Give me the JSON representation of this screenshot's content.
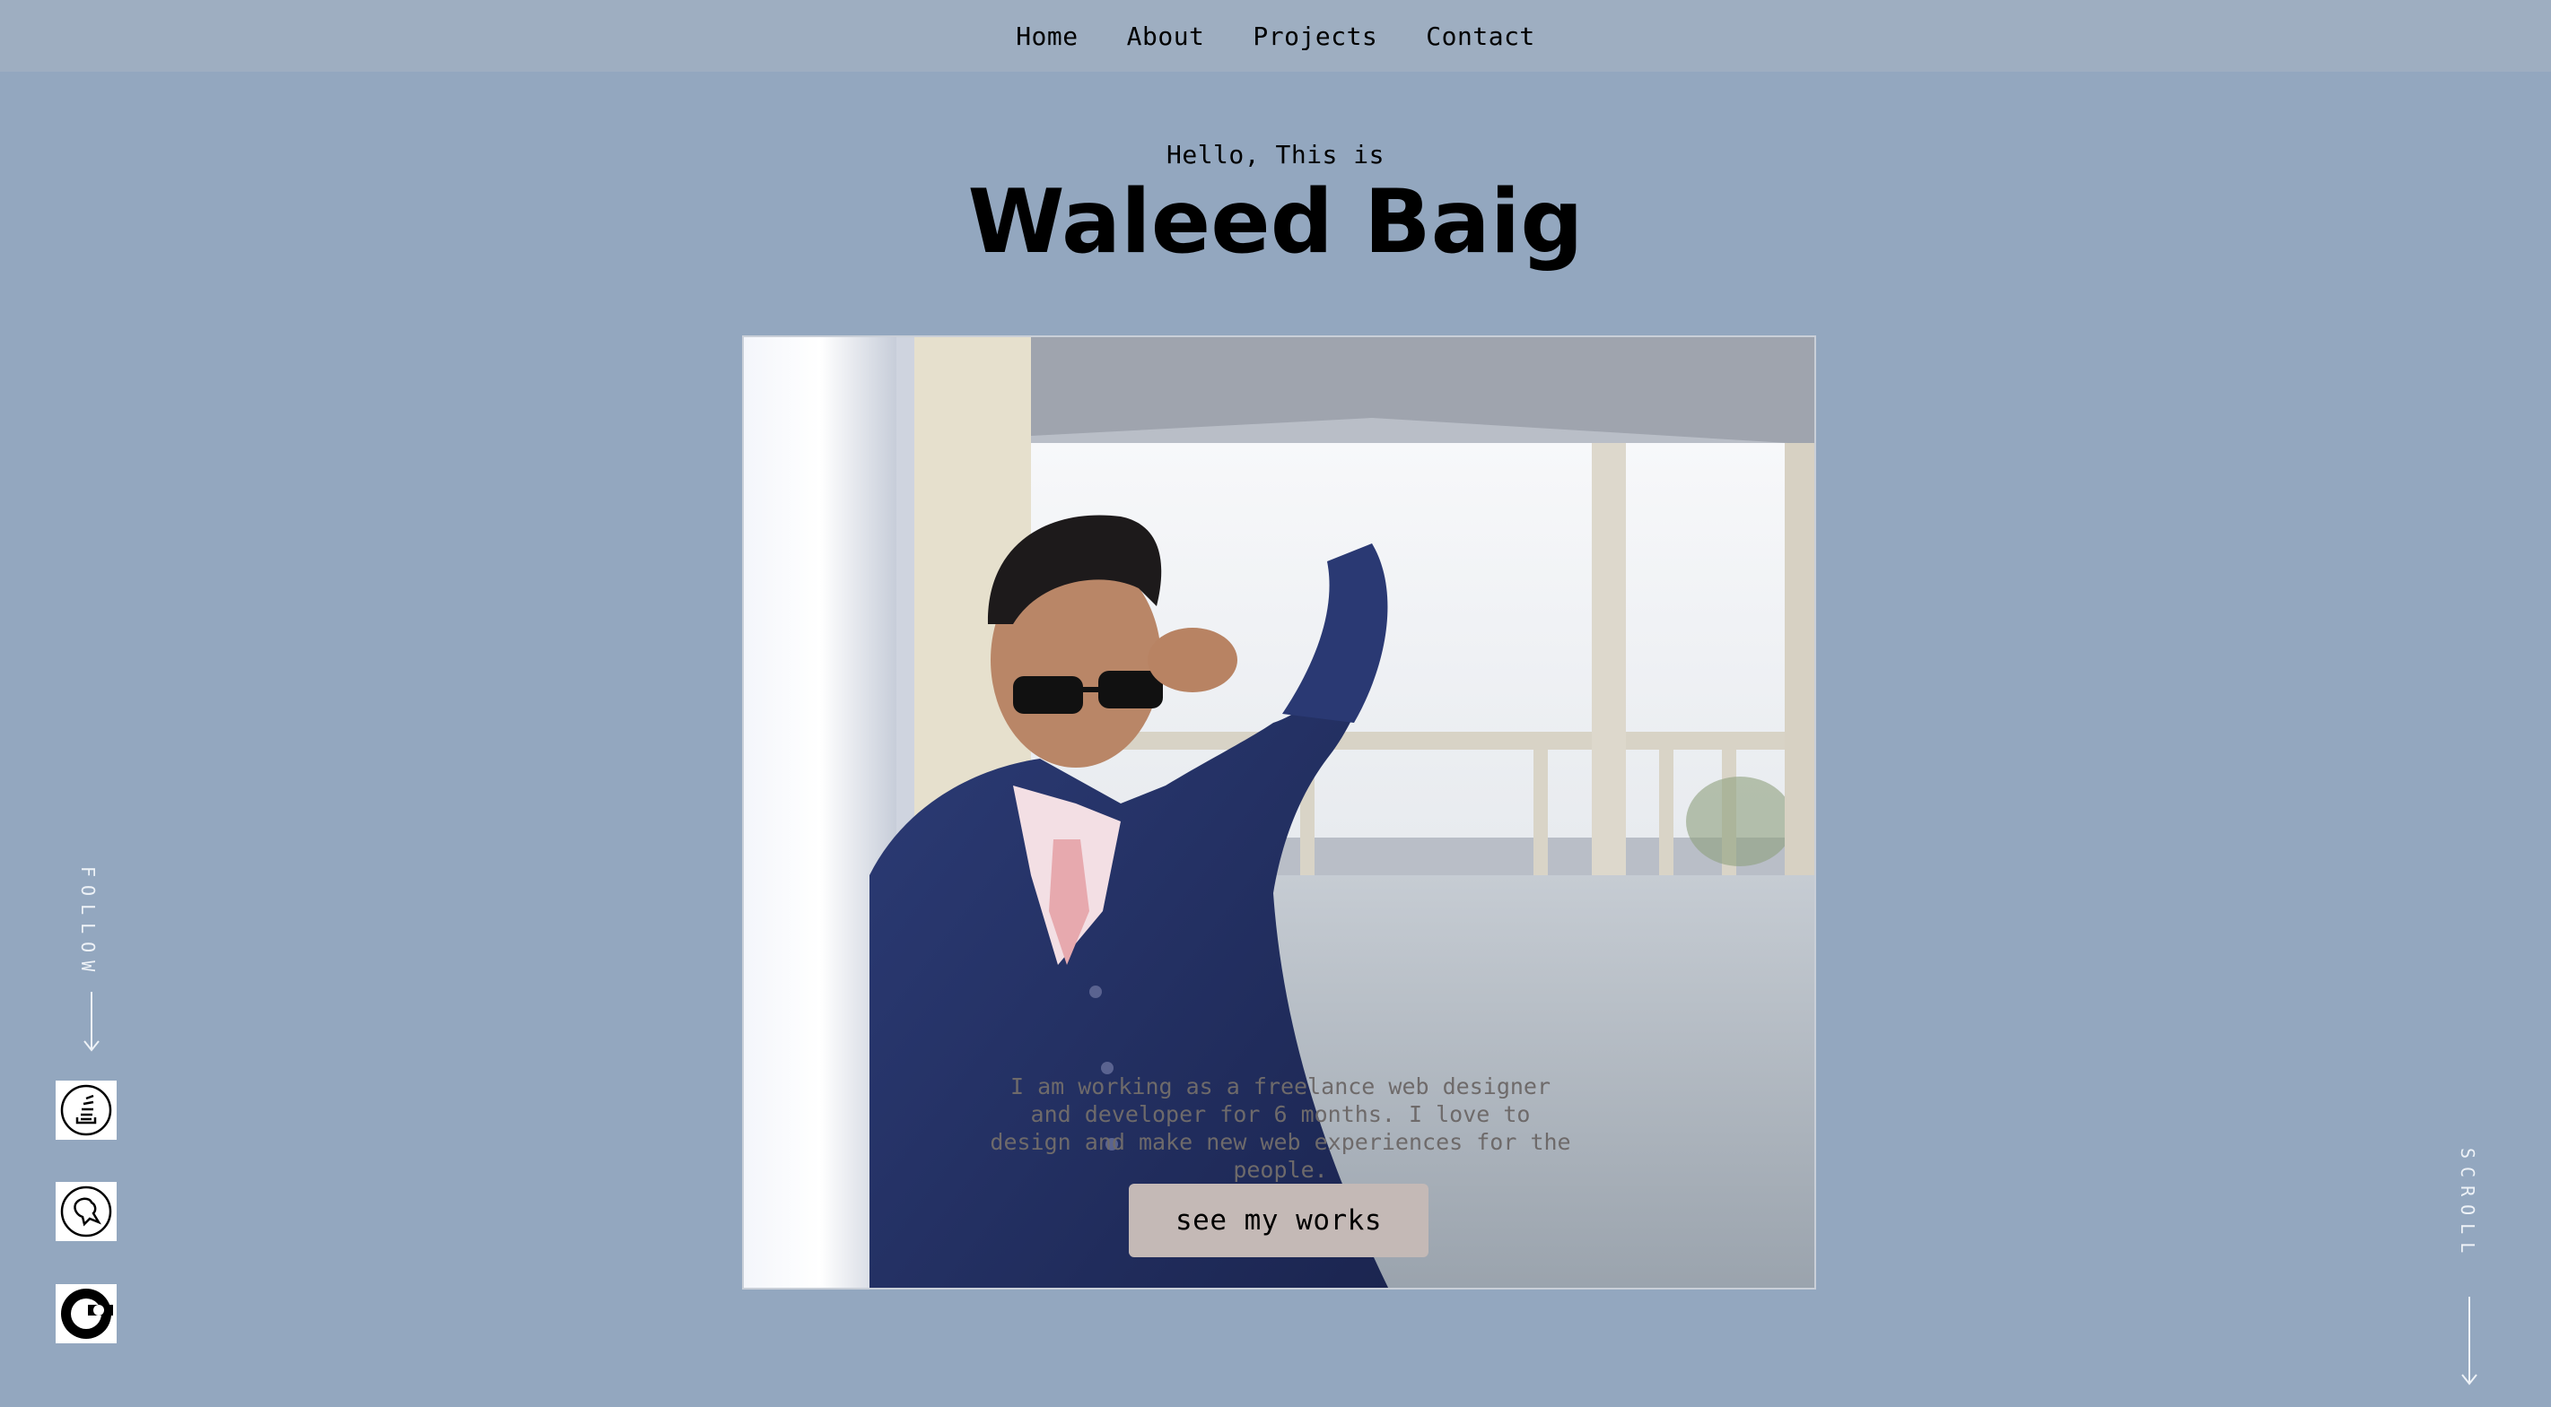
{
  "nav": {
    "items": [
      {
        "label": "Home"
      },
      {
        "label": "About"
      },
      {
        "label": "Projects"
      },
      {
        "label": "Contact"
      }
    ]
  },
  "hero": {
    "greeting": "Hello, This is",
    "name": "Waleed Baig",
    "bio": "I am working as a freelance web designer and developer for 6 months. I love to design and make new web experiences for the people.",
    "cta_label": "see my works"
  },
  "follow": {
    "label": "FOLLOW",
    "icons": [
      "stackoverflow-icon",
      "codepen-like-icon",
      "github-like-icon"
    ]
  },
  "scroll": {
    "label": "SCROLL"
  },
  "colors": {
    "background": "#93a7bf",
    "nav_background": "#9eaec1",
    "button": "#c4b9b6",
    "suit": "#263468"
  }
}
